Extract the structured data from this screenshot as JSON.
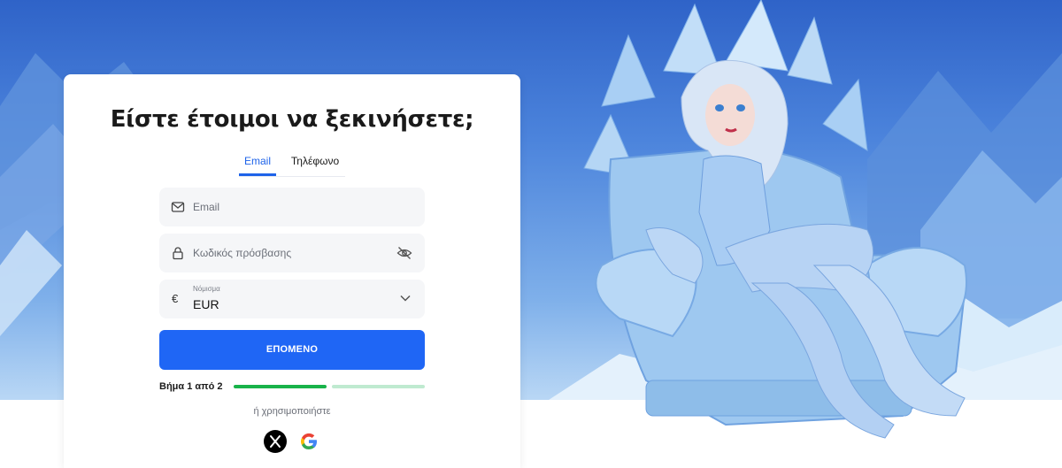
{
  "signup": {
    "title": "Είστε έτοιμοι να ξεκινήσετε;",
    "tabs": [
      {
        "label": "Email",
        "active": true
      },
      {
        "label": "Τηλέφωνο",
        "active": false
      }
    ],
    "email_field": {
      "placeholder": "Email",
      "icon": "mail-icon"
    },
    "password_field": {
      "placeholder": "Κωδικός πρόσβασης",
      "icon": "lock-icon",
      "toggle_icon": "eye-off-icon"
    },
    "currency_field": {
      "label": "Νόμισμα",
      "value": "EUR",
      "symbol": "€"
    },
    "next_button": {
      "label": "ΕΠΟΜΕΝΟ"
    },
    "step": {
      "label": "Βήμα 1 από 2",
      "current": 1,
      "total": 2
    },
    "or_text": "ή χρησιμοποιήστε",
    "social": [
      {
        "name": "x",
        "icon": "x-logo-icon"
      },
      {
        "name": "google",
        "icon": "google-logo-icon"
      }
    ]
  },
  "colors": {
    "primary": "#1f66f5",
    "progress_done": "#18b34a",
    "progress_todo": "#bfead0",
    "hero_sky": "#4c84dc"
  }
}
